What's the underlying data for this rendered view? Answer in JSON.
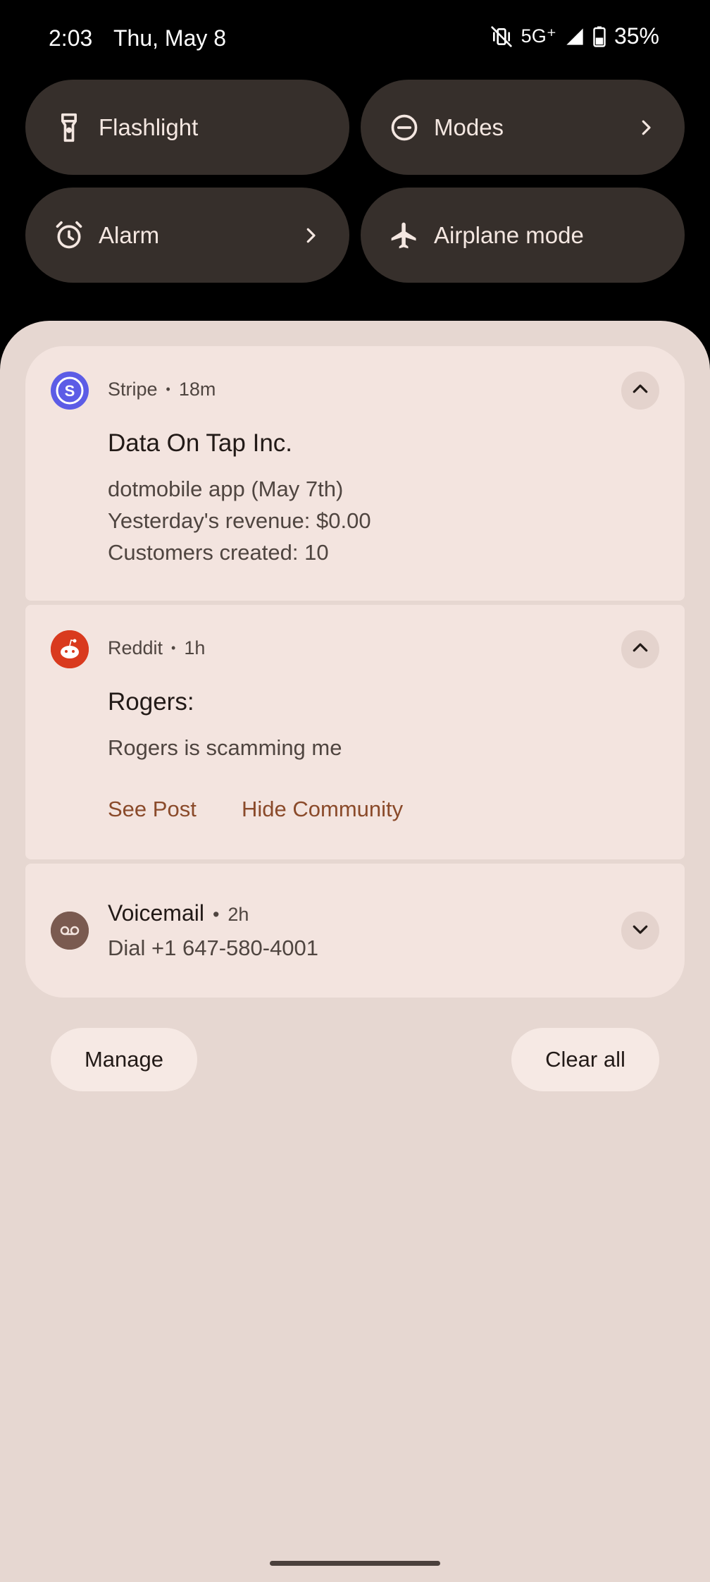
{
  "status_bar": {
    "time": "2:03",
    "date": "Thu, May 8",
    "network": "5G⁺",
    "battery": "35%"
  },
  "quick_tiles": [
    {
      "label": "Flashlight",
      "icon": "flashlight-icon",
      "has_chevron": false
    },
    {
      "label": "Modes",
      "icon": "do-not-disturb-icon",
      "has_chevron": true
    },
    {
      "label": "Alarm",
      "icon": "alarm-clock-icon",
      "has_chevron": true
    },
    {
      "label": "Airplane mode",
      "icon": "airplane-icon",
      "has_chevron": false
    }
  ],
  "notifications": {
    "stripe": {
      "app": "Stripe",
      "time": "18m",
      "title": "Data On Tap Inc.",
      "lines": [
        "dotmobile app (May 7th)",
        "Yesterday's revenue: $0.00",
        "Customers created: 10"
      ],
      "icon_color": "#5c5ce6"
    },
    "reddit": {
      "app": "Reddit",
      "time": "1h",
      "title": "Rogers:",
      "body": "Rogers is scamming me",
      "actions": [
        "See Post",
        "Hide Community"
      ],
      "icon_color": "#d93a1e"
    },
    "voicemail": {
      "app": "Voicemail",
      "time": "2h",
      "body": "Dial +1 647-580-4001",
      "icon_color": "#7a5a50"
    }
  },
  "footer": {
    "manage": "Manage",
    "clear_all": "Clear all"
  },
  "colors": {
    "tile_bg": "#362f2b",
    "shade_bg": "#e6d7d1",
    "card_bg": "#f3e4df",
    "action_color": "#8a4a2a"
  }
}
